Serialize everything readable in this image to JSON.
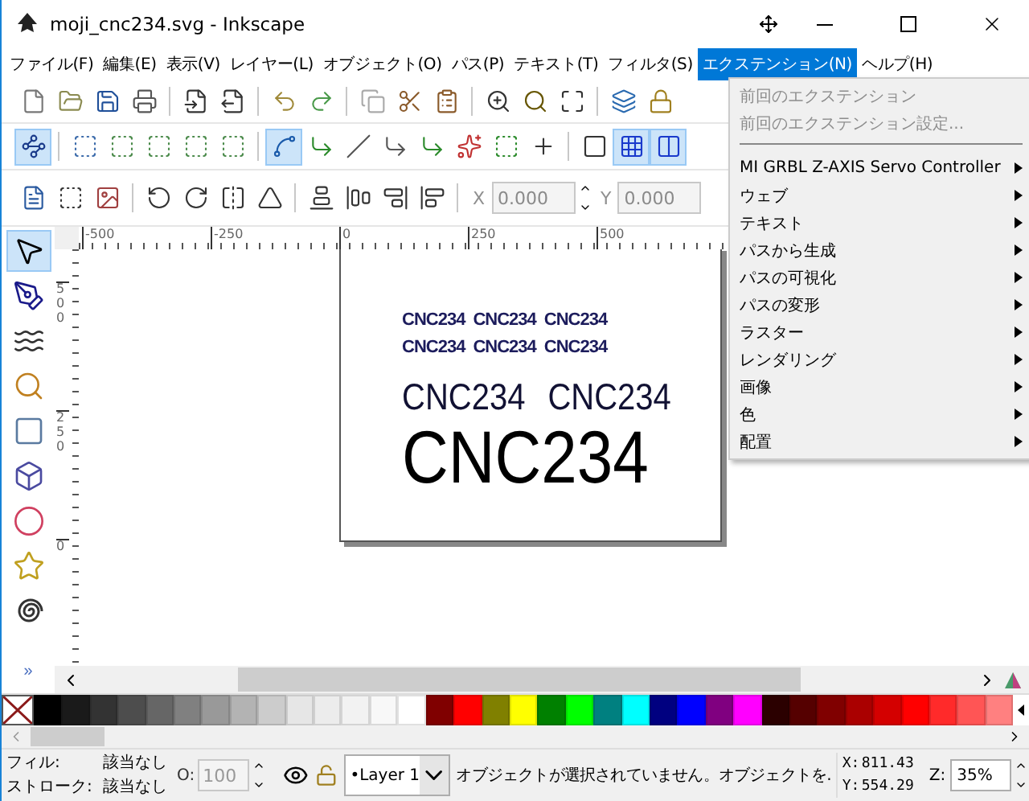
{
  "window": {
    "title": "moji_cnc234.svg - Inkscape"
  },
  "menu_bar": [
    {
      "label": "ファイル(F)",
      "selected": false
    },
    {
      "label": "編集(E)",
      "selected": false
    },
    {
      "label": "表示(V)",
      "selected": false
    },
    {
      "label": "レイヤー(L)",
      "selected": false
    },
    {
      "label": "オブジェクト(O)",
      "selected": false
    },
    {
      "label": "パス(P)",
      "selected": false
    },
    {
      "label": "テキスト(T)",
      "selected": false
    },
    {
      "label": "フィルタ(S)",
      "selected": false
    },
    {
      "label": "エクステンション(N)",
      "selected": true
    },
    {
      "label": "ヘルプ(H)",
      "selected": false
    }
  ],
  "extensions_menu": [
    {
      "kind": "item",
      "label": "前回のエクステンション",
      "disabled": true,
      "submenu": false
    },
    {
      "kind": "item",
      "label": "前回のエクステンション設定...",
      "disabled": true,
      "submenu": false
    },
    {
      "kind": "separator"
    },
    {
      "kind": "item",
      "label": "MI GRBL Z-AXIS Servo Controller",
      "disabled": false,
      "submenu": true
    },
    {
      "kind": "item",
      "label": "ウェブ",
      "disabled": false,
      "submenu": true
    },
    {
      "kind": "item",
      "label": "テキスト",
      "disabled": false,
      "submenu": true
    },
    {
      "kind": "item",
      "label": "パスから生成",
      "disabled": false,
      "submenu": true
    },
    {
      "kind": "item",
      "label": "パスの可視化",
      "disabled": false,
      "submenu": true
    },
    {
      "kind": "item",
      "label": "パスの変形",
      "disabled": false,
      "submenu": true
    },
    {
      "kind": "item",
      "label": "ラスター",
      "disabled": false,
      "submenu": true
    },
    {
      "kind": "item",
      "label": "レンダリング",
      "disabled": false,
      "submenu": true
    },
    {
      "kind": "item",
      "label": "画像",
      "disabled": false,
      "submenu": true
    },
    {
      "kind": "item",
      "label": "色",
      "disabled": false,
      "submenu": true
    },
    {
      "kind": "item",
      "label": "配置",
      "disabled": false,
      "submenu": true
    }
  ],
  "snap_toolbar": [
    {
      "on": true
    },
    {
      "on": false
    },
    {
      "on": false
    },
    {
      "on": false
    },
    {
      "on": false
    },
    {
      "on": false
    },
    {
      "on": true
    },
    {
      "on": false
    },
    {
      "on": false
    },
    {
      "on": false
    },
    {
      "on": false
    },
    {
      "on": false
    },
    {
      "on": false
    },
    {
      "on": false
    },
    {
      "on": false
    },
    {
      "on": true
    },
    {
      "on": true
    }
  ],
  "transform_toolbar": {
    "x_label": "X",
    "x_value": "0.000",
    "y_label": "Y",
    "y_value": "0.000"
  },
  "tools": [
    {
      "selected": true
    },
    {
      "selected": false
    },
    {
      "selected": false
    },
    {
      "selected": false
    },
    {
      "selected": false
    },
    {
      "selected": false
    },
    {
      "selected": false
    },
    {
      "selected": false
    },
    {
      "selected": false
    }
  ],
  "toolbox_more": "»",
  "ruler": {
    "horizontal": [
      "-500",
      "-250",
      "0",
      "250",
      "500"
    ],
    "vertical": [
      "500",
      "250",
      "0"
    ]
  },
  "canvas": {
    "text_rows": [
      {
        "kind": "small",
        "items": [
          "CNC234",
          "CNC234",
          "CNC234"
        ]
      },
      {
        "kind": "small",
        "items": [
          "CNC234",
          "CNC234",
          "CNC234"
        ]
      },
      {
        "kind": "medium",
        "items": [
          "CNC234",
          "CNC234"
        ]
      },
      {
        "kind": "large",
        "items": [
          "CNC234"
        ]
      }
    ]
  },
  "palette": [
    {
      "color": "#000000"
    },
    {
      "color": "#1a1a1a"
    },
    {
      "color": "#333333"
    },
    {
      "color": "#4d4d4d"
    },
    {
      "color": "#666666"
    },
    {
      "color": "#808080"
    },
    {
      "color": "#999999"
    },
    {
      "color": "#b3b3b3"
    },
    {
      "color": "#cccccc"
    },
    {
      "color": "#e6e6e6"
    },
    {
      "color": "#ececec"
    },
    {
      "color": "#f2f2f2"
    },
    {
      "color": "#f8f8f8"
    },
    {
      "color": "#ffffff"
    },
    {
      "color": "#800000"
    },
    {
      "color": "#ff0000"
    },
    {
      "color": "#808000"
    },
    {
      "color": "#ffff00"
    },
    {
      "color": "#008000"
    },
    {
      "color": "#00ff00"
    },
    {
      "color": "#008080"
    },
    {
      "color": "#00ffff"
    },
    {
      "color": "#000080"
    },
    {
      "color": "#0000ff"
    },
    {
      "color": "#800080"
    },
    {
      "color": "#ff00ff"
    },
    {
      "color": "#2b0000"
    },
    {
      "color": "#550000"
    },
    {
      "color": "#800000"
    },
    {
      "color": "#aa0000"
    },
    {
      "color": "#d40000"
    },
    {
      "color": "#ff0000"
    },
    {
      "color": "#ff2a2a"
    },
    {
      "color": "#ff5555"
    },
    {
      "color": "#ff8080"
    }
  ],
  "status_bar": {
    "fill_label": "フィル:",
    "fill_value": "該当なし",
    "stroke_label": "ストローク:",
    "stroke_value": "該当なし",
    "opacity_label": "O:",
    "opacity_value": "100",
    "layer": "•Layer 1",
    "message": "オブジェクトが選択されていません。オブジェクトを.",
    "x_label": "X:",
    "x_value": "811.43",
    "y_label": "Y:",
    "y_value": "554.29",
    "zoom_label": "Z:",
    "zoom_value": "35%"
  }
}
